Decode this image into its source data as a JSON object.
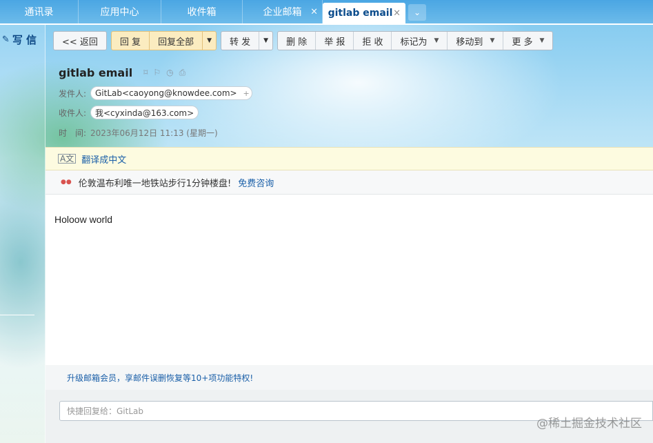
{
  "tabs": [
    {
      "label": "通讯录",
      "active": false
    },
    {
      "label": "应用中心",
      "active": false
    },
    {
      "label": "收件箱",
      "active": false
    },
    {
      "label": "企业邮箱",
      "active": false,
      "closable": true
    },
    {
      "label": "gitlab email",
      "active": true,
      "closable": true
    }
  ],
  "tab_close_glyph": "×",
  "tab_more_glyph": "⌄",
  "sidebar": {
    "compose_label": "写 信",
    "compose_icon": "pen-icon"
  },
  "toolbar": {
    "back": "<< 返回",
    "reply": "回 复",
    "reply_all": "回复全部",
    "forward": "转 发",
    "delete": "删 除",
    "report": "举 报",
    "reject": "拒 收",
    "mark_as": "标记为",
    "move_to": "移动到",
    "more": "更 多"
  },
  "email": {
    "subject": "gitlab email",
    "sender_label": "发件人:",
    "sender": "GitLab<caoyong@knowdee.com>",
    "recipient_label": "收件人:",
    "recipient": "我<cyxinda@163.com>",
    "time_label": "时　间:",
    "time": "2023年06月12日 11:13 (星期一)",
    "body": "Holoow world"
  },
  "translate": {
    "label": "翻译成中文"
  },
  "ad": {
    "text": "伦敦温布利唯一地铁站步行1分钟楼盘!",
    "link": "免费咨询"
  },
  "upgrade": {
    "text": "升级邮箱会员，享邮件误删恢复等10+项功能特权!"
  },
  "quick_reply": {
    "placeholder": "快捷回复给：GitLab"
  },
  "watermark": "@稀土掘金技术社区",
  "colors": {
    "tab_bar": "#4aa6e3",
    "link": "#1a5fa8",
    "compose": "#0e4a86"
  }
}
